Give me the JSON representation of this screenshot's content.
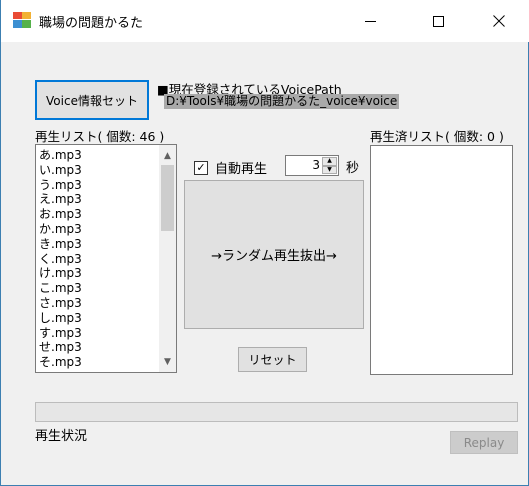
{
  "window": {
    "title": "職場の問題かるた",
    "icon": "app-grid-icon"
  },
  "controls": {
    "voice_button": "Voice情報セット",
    "path_label": "■現在登録されているVoicePath",
    "path_value": "D:¥Tools¥職場の問題かるた_voice¥voice",
    "auto_play_label": "自動再生",
    "auto_play_checked": true,
    "interval_value": "3",
    "interval_unit": "秒",
    "random_button": "→ランダム再生抜出→",
    "reset_button": "リセット",
    "replay_button": "Replay",
    "replay_enabled": false
  },
  "play_list": {
    "label": "再生リスト( 個数: 46 )",
    "items": [
      "あ.mp3",
      "い.mp3",
      "う.mp3",
      "え.mp3",
      "お.mp3",
      "か.mp3",
      "き.mp3",
      "く.mp3",
      "け.mp3",
      "こ.mp3",
      "さ.mp3",
      "し.mp3",
      "す.mp3",
      "せ.mp3",
      "そ.mp3"
    ]
  },
  "played_list": {
    "label": "再生済リスト( 個数: 0 )",
    "items": []
  },
  "status": {
    "label": "再生状況",
    "progress": 0
  }
}
